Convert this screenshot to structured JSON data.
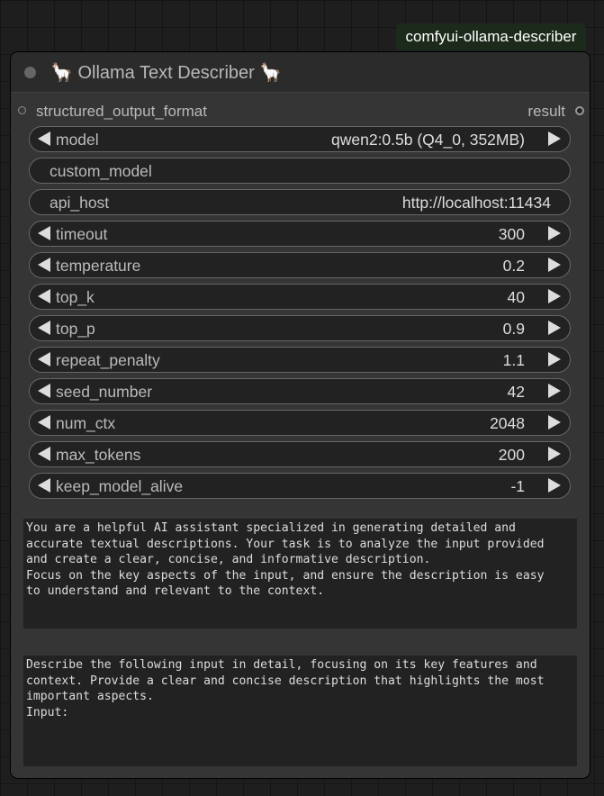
{
  "badge": "comfyui-ollama-describer",
  "node": {
    "title": "🦙 Ollama Text Describer 🦙",
    "input_label": "structured_output_format",
    "output_label": "result"
  },
  "widgets": {
    "model": {
      "label": "model",
      "value": "qwen2:0.5b (Q4_0, 352MB)"
    },
    "custom_model": {
      "label": "custom_model",
      "value": ""
    },
    "api_host": {
      "label": "api_host",
      "value": "http://localhost:11434"
    },
    "timeout": {
      "label": "timeout",
      "value": "300"
    },
    "temperature": {
      "label": "temperature",
      "value": "0.2"
    },
    "top_k": {
      "label": "top_k",
      "value": "40"
    },
    "top_p": {
      "label": "top_p",
      "value": "0.9"
    },
    "repeat_penalty": {
      "label": "repeat_penalty",
      "value": "1.1"
    },
    "seed_number": {
      "label": "seed_number",
      "value": "42"
    },
    "num_ctx": {
      "label": "num_ctx",
      "value": "2048"
    },
    "max_tokens": {
      "label": "max_tokens",
      "value": "200"
    },
    "keep_model_alive": {
      "label": "keep_model_alive",
      "value": "-1"
    }
  },
  "system_prompt": "You are a helpful AI assistant specialized in generating detailed and\naccurate textual descriptions. Your task is to analyze the input provided\nand create a clear, concise, and informative description.\nFocus on the key aspects of the input, and ensure the description is easy\nto understand and relevant to the context.",
  "user_prompt": "Describe the following input in detail, focusing on its key features and\ncontext. Provide a clear and concise description that highlights the most\nimportant aspects.\nInput:"
}
